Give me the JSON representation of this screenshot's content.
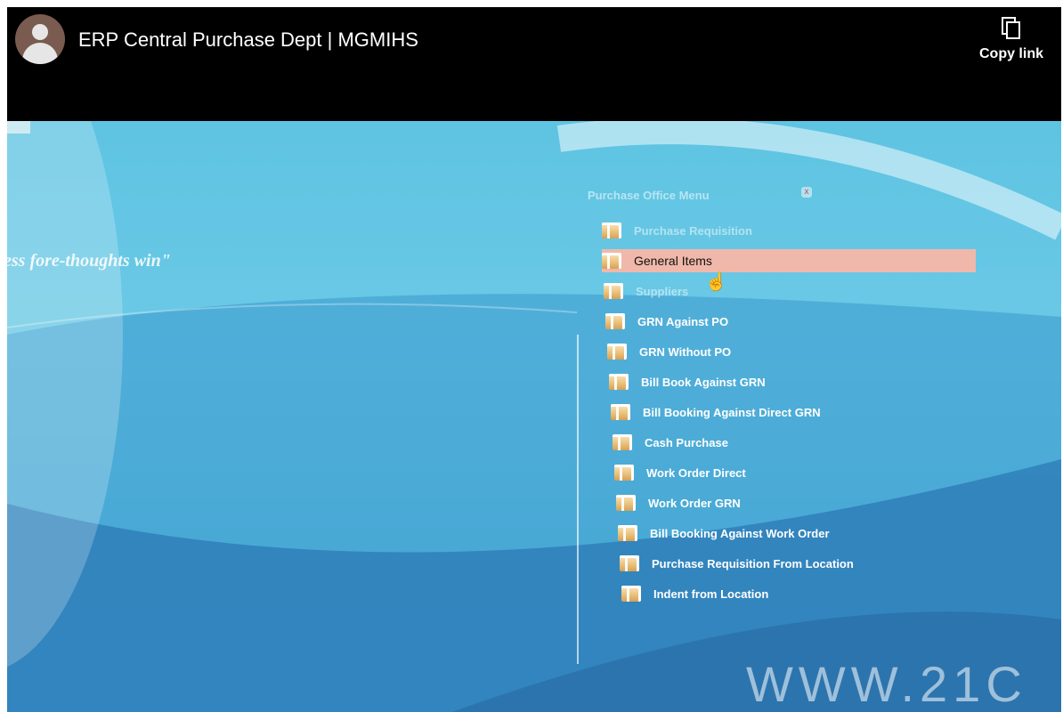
{
  "header": {
    "title": "ERP Central Purchase Dept | MGMIHS",
    "copy_link": "Copy link",
    "copy_icon": "copy-icon",
    "avatar_icon": "user-avatar-icon"
  },
  "video": {
    "tagline": "ess fore-thoughts win\"",
    "menu_title": "Purchase Office Menu",
    "menu_items": [
      {
        "label": "Purchase Requisition"
      },
      {
        "label": "General Items"
      },
      {
        "label": "Suppliers"
      },
      {
        "label": "GRN Against PO"
      },
      {
        "label": "GRN Without PO"
      },
      {
        "label": "Bill Book Against GRN"
      },
      {
        "label": "Bill Booking Against Direct GRN"
      },
      {
        "label": "Cash Purchase"
      },
      {
        "label": "Work Order Direct"
      },
      {
        "label": "Work Order GRN"
      },
      {
        "label": "Bill Booking Against Work Order"
      },
      {
        "label": "Purchase Requisition From Location"
      },
      {
        "label": "Indent from Location"
      }
    ],
    "watermark": "WWW.21C"
  },
  "colors": {
    "selected_row": "#f0b8aa",
    "folder_icon": "#e9c07a",
    "sky": "#5ec4e2"
  }
}
